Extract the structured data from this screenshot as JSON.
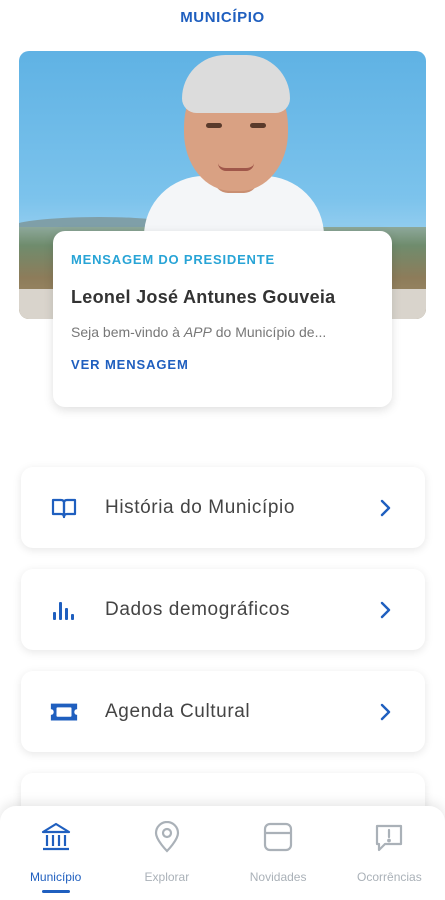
{
  "header": {
    "title": "MUNICÍPIO"
  },
  "president": {
    "kicker": "MENSAGEM DO PRESIDENTE",
    "name": "Leonel José Antunes Gouveia",
    "excerpt_prefix": "Seja bem-vindo à ",
    "excerpt_app": "APP",
    "excerpt_suffix": " do Município de...",
    "link_label": "VER MENSAGEM"
  },
  "menu": {
    "items": [
      {
        "label": "História do Município",
        "icon": "book-icon"
      },
      {
        "label": "Dados demográficos",
        "icon": "bar-chart-icon"
      },
      {
        "label": "Agenda Cultural",
        "icon": "ticket-icon"
      }
    ]
  },
  "bottom_nav": {
    "items": [
      {
        "label": "Município",
        "icon": "townhall-icon",
        "active": true
      },
      {
        "label": "Explorar",
        "icon": "location-pin-icon",
        "active": false
      },
      {
        "label": "Novidades",
        "icon": "news-icon",
        "active": false
      },
      {
        "label": "Ocorrências",
        "icon": "alert-message-icon",
        "active": false
      }
    ]
  },
  "colors": {
    "primary": "#1f5fbf",
    "accent": "#28a4d6",
    "text": "#333333",
    "muted": "#777777",
    "nav_inactive": "#aab1b8"
  }
}
